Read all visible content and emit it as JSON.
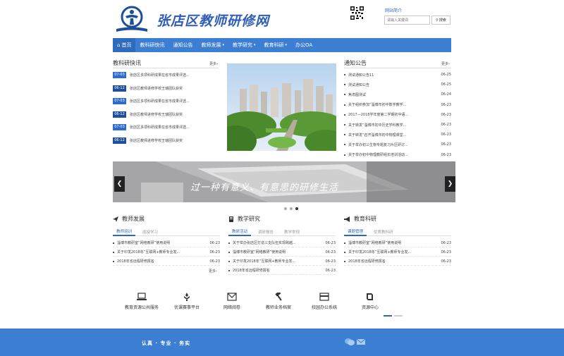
{
  "header": {
    "site_title": "张店区教师研修网",
    "intro_link": "网站简介",
    "search_placeholder": "请输入关键词",
    "search_label": "搜索"
  },
  "nav": [
    {
      "label": "首页",
      "icon": "home-icon",
      "caret": false
    },
    {
      "label": "教科研快讯",
      "caret": false
    },
    {
      "label": "通知公告",
      "caret": false
    },
    {
      "label": "教师发展",
      "caret": true
    },
    {
      "label": "教学研究",
      "caret": true
    },
    {
      "label": "教育科研",
      "caret": true
    },
    {
      "label": "办公OA",
      "caret": false
    }
  ],
  "news": {
    "title": "教科研快讯",
    "more": "更多",
    "items": [
      {
        "date": "07-03",
        "text": "张店区多项科研成果在省市成果评选...",
        "color": "#2e6bd0"
      },
      {
        "date": "06-12",
        "text": "张店区教师进修学校王瑞团队获奖",
        "color": "#1f4f9a"
      },
      {
        "date": "07-03",
        "text": "张店区多项科研成果在省市成果评选...",
        "color": "#2e6bd0"
      },
      {
        "date": "06-12",
        "text": "张店区教师进修学校王瑞团队获奖",
        "color": "#1f4f9a"
      },
      {
        "date": "07-03",
        "text": "张店区多项科研成果在省市成果评选...",
        "color": "#2e6bd0"
      },
      {
        "date": "06-12",
        "text": "张店区教师进修学校王瑞团队获奖",
        "color": "#1f4f9a"
      }
    ]
  },
  "notices": {
    "title": "通知公告",
    "more": "更多",
    "items": [
      {
        "text": "测试通知公告11",
        "date": "06-25"
      },
      {
        "text": "测试通知公告",
        "date": "06-25"
      },
      {
        "text": "焦虑图测试",
        "date": "06-24"
      },
      {
        "text": "关于组织参加“淄博市初中数学教学...",
        "date": "06-23"
      },
      {
        "text": "2017—2018学年度第二学期初中语...",
        "date": "06-23"
      },
      {
        "text": "关于转发“淄博市初中历史学科教学...",
        "date": "06-23"
      },
      {
        "text": "关于转发“召开淄博市初中物理课堂...",
        "date": "06-23"
      },
      {
        "text": "关于举办初三生物专题复习片区研讨...",
        "date": "06-23"
      },
      {
        "text": "关于举办初中物理教研组长培训活动...",
        "date": "06-23"
      }
    ]
  },
  "banner": {
    "text": "过一种有意义、有意思的研修生活",
    "slide_count": 3,
    "active_slide": 3
  },
  "columns": [
    {
      "title": "教师发展",
      "icon": "send-icon",
      "tabs": [
        "教师培训",
        "函授学习"
      ],
      "active_tab": 0,
      "rows": [
        {
          "text": "淄博市教研室“网络教研”使用说明",
          "date": "06-23"
        },
        {
          "text": "关于印发2018年“互联网+教师专业发...",
          "date": "06-23"
        },
        {
          "text": "2018年省远程研修报名",
          "date": "06-23"
        }
      ],
      "more": "更多"
    },
    {
      "title": "教学研究",
      "icon": "book-icon",
      "tabs": [
        "教研活动",
        "调研报告",
        "教学常规"
      ],
      "active_tab": 0,
      "rows": [
        {
          "text": "关于举办张店区打造三支队伍实现跨越...",
          "date": "06-23"
        },
        {
          "text": "淄博市教研室“网络教研”使用说明",
          "date": "06-23"
        },
        {
          "text": "关于印发2018年“互联网+教师专业发...",
          "date": "06-23"
        },
        {
          "text": "2018年省远程研修报名",
          "date": "06-23"
        }
      ]
    },
    {
      "title": "教育科研",
      "icon": "megaphone-icon",
      "tabs": [
        "课题管理",
        "优质教科研"
      ],
      "active_tab": 0,
      "rows": [
        {
          "text": "淄博市教研室“网络教研”使用说明",
          "date": "06-23"
        },
        {
          "text": "关于印发2018年“互联网+教师专业发...",
          "date": "06-23"
        },
        {
          "text": "2018年省远程研修报名",
          "date": "06-23"
        }
      ]
    }
  ],
  "services": [
    {
      "label": "教育资源公共服务",
      "icon": "laptop-icon"
    },
    {
      "label": "优课赛事平台",
      "icon": "trophy-icon"
    },
    {
      "label": "网络阅卷",
      "icon": "mail-icon"
    },
    {
      "label": "教师业务档案",
      "icon": "gavel-icon"
    },
    {
      "label": "校园办公系统",
      "icon": "card-icon"
    },
    {
      "label": "资源中心",
      "icon": "book-open-icon"
    }
  ],
  "footer": {
    "motto": "认真 · 专业 · 务实",
    "icons": [
      "wechat-icon",
      "email-icon"
    ]
  }
}
